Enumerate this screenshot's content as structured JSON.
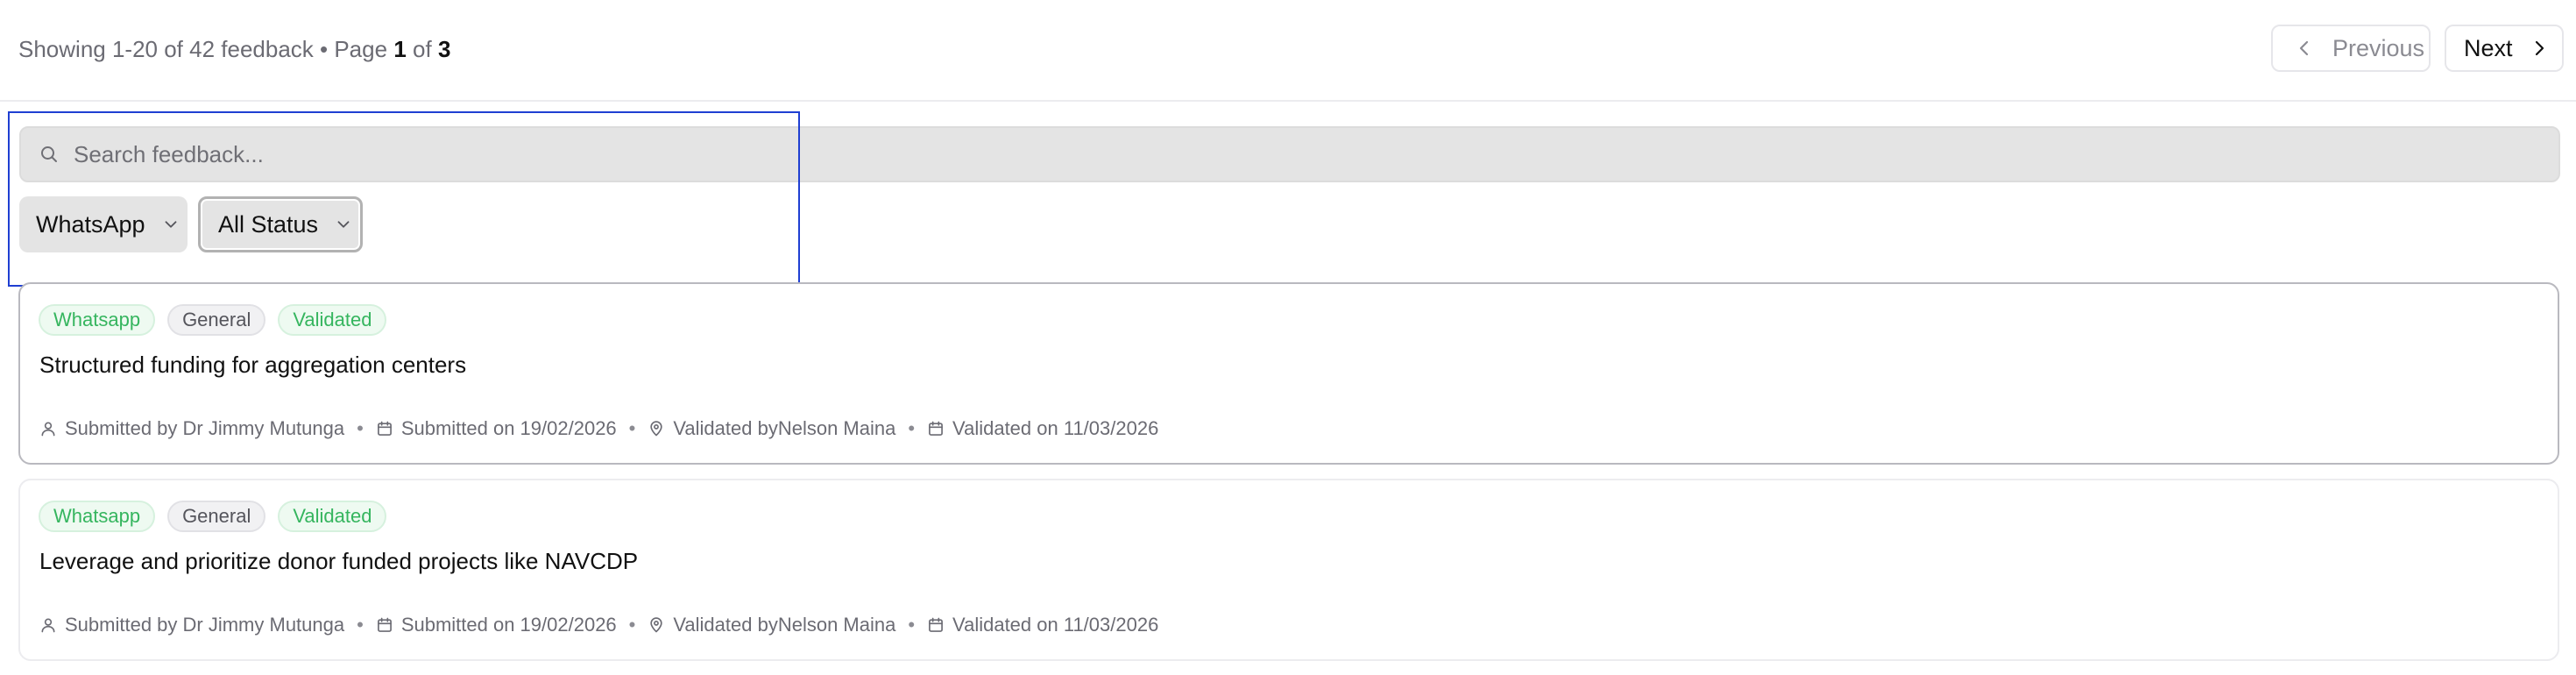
{
  "pagination": {
    "showing_prefix": "Showing 1-20 of 42 feedback • Page",
    "current_page": "1",
    "of_label": "of",
    "total_pages": "3",
    "previous_label": "Previous",
    "next_label": "Next"
  },
  "search": {
    "placeholder": "Search feedback...",
    "value": ""
  },
  "filters": {
    "channel_selected": "WhatsApp",
    "status_selected": "All Status"
  },
  "colors": {
    "badge_green": "#35b55e",
    "focus_outline": "#1f3fd2"
  },
  "feedback": [
    {
      "tags": [
        "Whatsapp",
        "General",
        "Validated"
      ],
      "title": "Structured funding for aggregation centers",
      "submitted_by": "Submitted by Dr Jimmy Mutunga",
      "submitted_on": "Submitted on 19/02/2026",
      "validated_by": "Validated byNelson Maina",
      "validated_on": "Validated on 11/03/2026"
    },
    {
      "tags": [
        "Whatsapp",
        "General",
        "Validated"
      ],
      "title": "Leverage and prioritize donor funded projects like NAVCDP",
      "submitted_by": "Submitted by Dr Jimmy Mutunga",
      "submitted_on": "Submitted on 19/02/2026",
      "validated_by": "Validated byNelson Maina",
      "validated_on": "Validated on 11/03/2026"
    }
  ]
}
